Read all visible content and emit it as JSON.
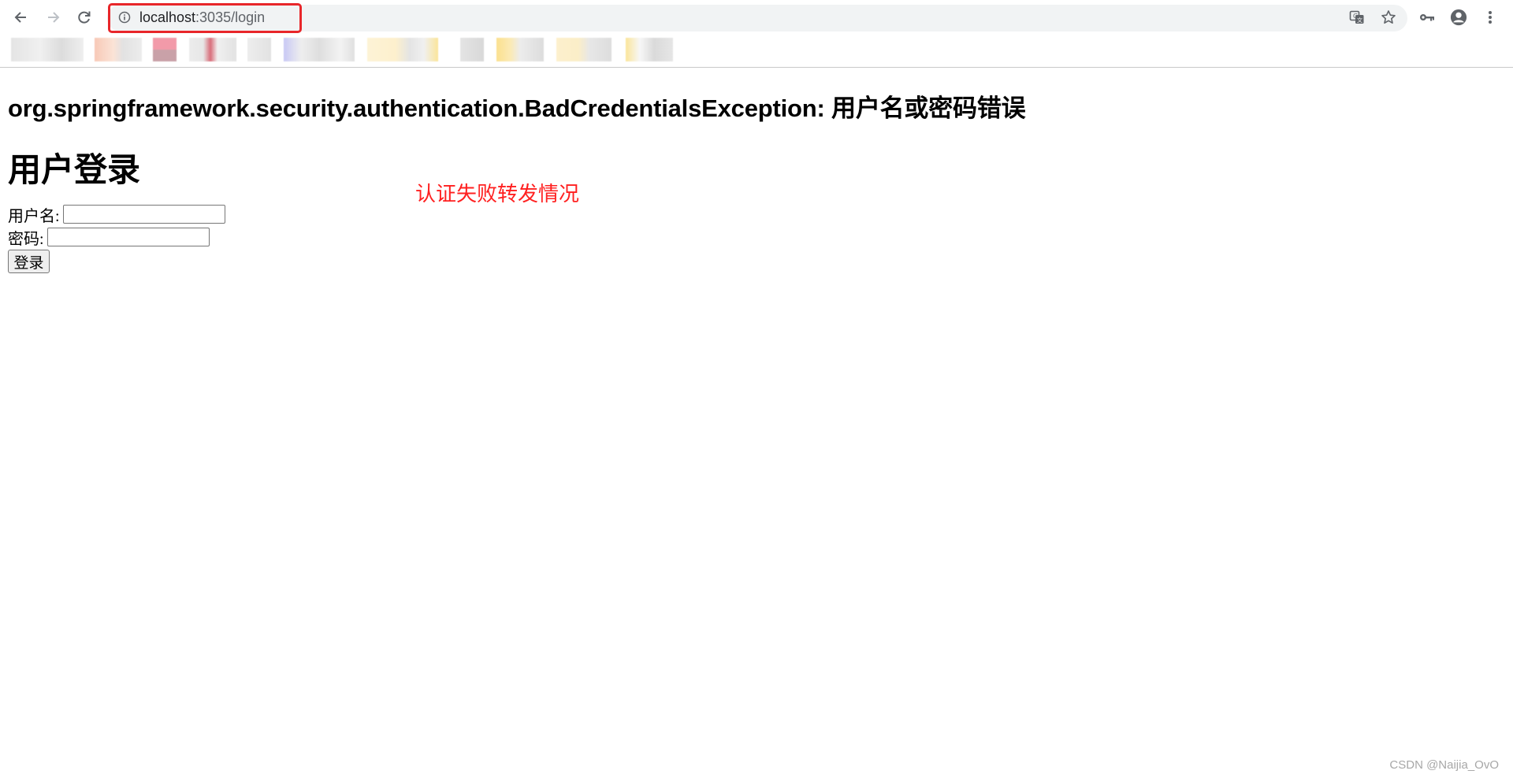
{
  "browser": {
    "url_host": "localhost",
    "url_path": ":3035/login",
    "icons": [
      "back-icon",
      "forward-icon",
      "reload-icon",
      "site-info-icon",
      "translate-icon",
      "bookmark-star-icon",
      "key-icon",
      "profile-icon",
      "menu-icon"
    ]
  },
  "page": {
    "error_message": "org.springframework.security.authentication.BadCredentialsException: 用户名或密码错误",
    "title": "用户登录",
    "form": {
      "username_label": "用户名:",
      "username_value": "",
      "password_label": "密码:",
      "password_value": "",
      "submit_label": "登录"
    }
  },
  "annotation": {
    "text": "认证失败转发情况",
    "color": "#ff2020"
  },
  "watermark": "CSDN @Naijia_OvO",
  "colors": {
    "highlight_box": "#e8262a",
    "omnibox_bg": "#f1f3f4"
  }
}
